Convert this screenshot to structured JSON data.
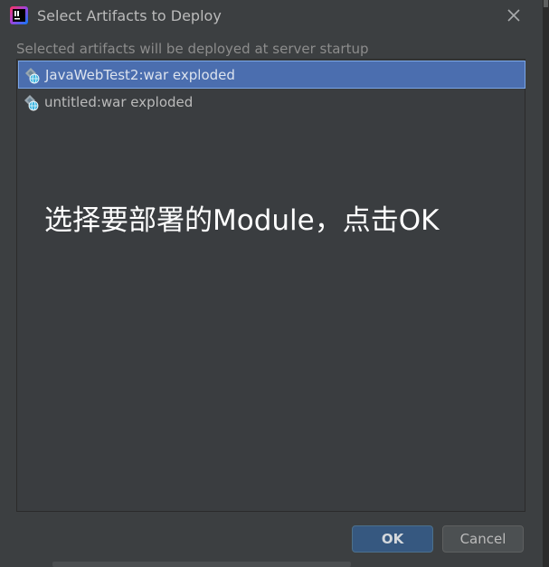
{
  "dialog": {
    "title": "Select Artifacts to Deploy",
    "instruction": "Selected artifacts will be deployed at server startup"
  },
  "artifacts": {
    "items": [
      {
        "label": "JavaWebTest2:war exploded",
        "selected": true
      },
      {
        "label": "untitled:war exploded",
        "selected": false
      }
    ]
  },
  "annotation": {
    "text": "选择要部署的Module，点击OK"
  },
  "buttons": {
    "ok_label": "OK",
    "cancel_label": "Cancel"
  },
  "icons": {
    "app": "intellij-idea-icon",
    "close": "close-icon",
    "artifact": "web-artifact-icon"
  },
  "colors": {
    "background": "#3c3f41",
    "selection": "#4b6eaf",
    "ok_button": "#365880"
  }
}
